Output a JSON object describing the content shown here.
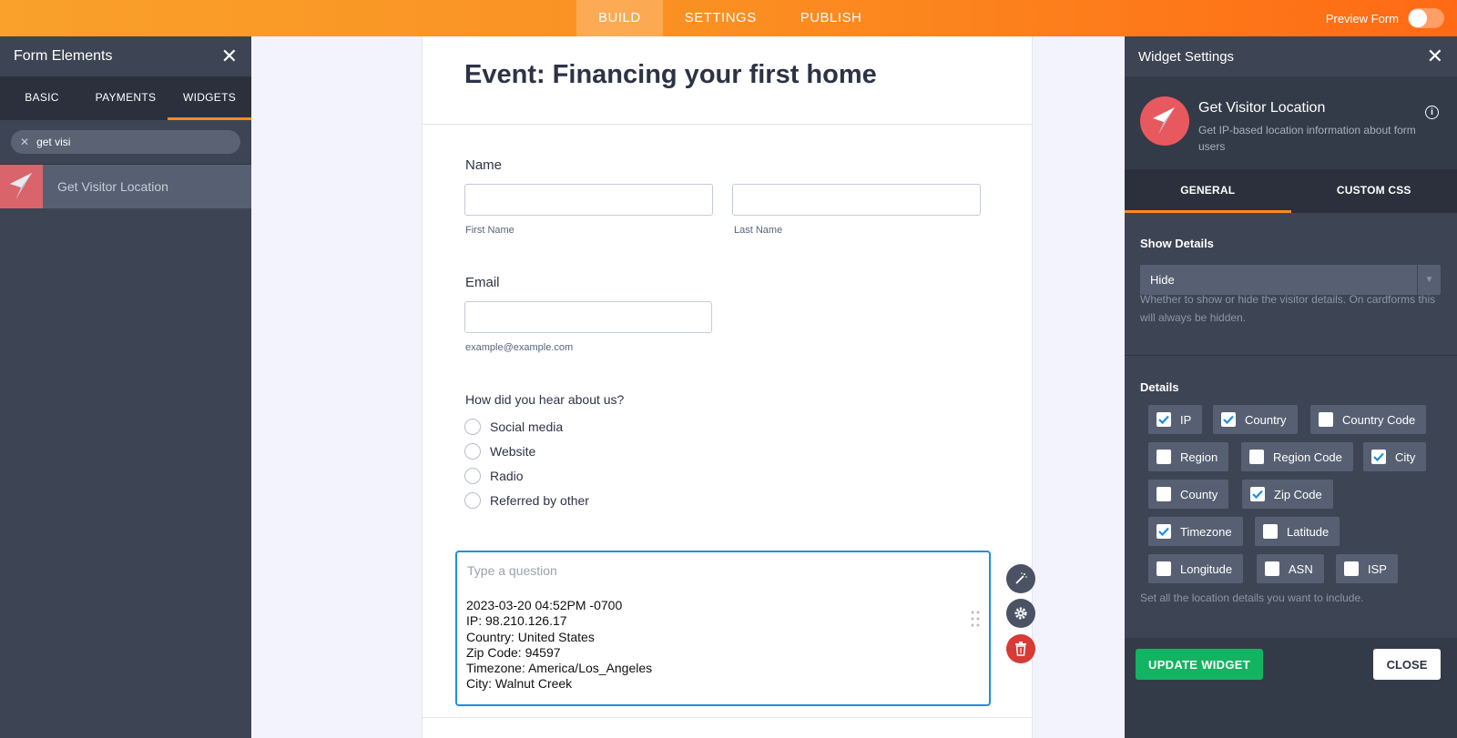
{
  "topbar": {
    "tabs": [
      "BUILD",
      "SETTINGS",
      "PUBLISH"
    ],
    "active_tab": "BUILD",
    "preview_label": "Preview Form",
    "preview_on": false
  },
  "left_panel": {
    "title": "Form Elements",
    "tabs": [
      "BASIC",
      "PAYMENTS",
      "WIDGETS"
    ],
    "active_tab": "WIDGETS",
    "search_value": "get visi",
    "result_label": "Get Visitor Location"
  },
  "form": {
    "title": "Event: Financing your first home",
    "name_label": "Name",
    "first_name_sublabel": "First Name",
    "last_name_sublabel": "Last Name",
    "email_label": "Email",
    "email_sublabel": "example@example.com",
    "hear_label": "How did you hear about us?",
    "hear_options": [
      "Social media",
      "Website",
      "Radio",
      "Referred by other"
    ],
    "question_placeholder": "Type a question",
    "widget_output": [
      "2023-03-20 04:52PM -0700",
      "IP: 98.210.126.17",
      "Country: United States",
      "Zip Code: 94597",
      "Timezone: America/Los_Angeles",
      "City: Walnut Creek"
    ]
  },
  "right_panel": {
    "title": "Widget Settings",
    "widget_name": "Get Visitor Location",
    "widget_desc": "Get IP-based location information about form users",
    "tabs": [
      "GENERAL",
      "CUSTOM CSS"
    ],
    "active_tab": "GENERAL",
    "show_details_label": "Show Details",
    "show_details_value": "Hide",
    "show_details_help": "Whether to show or hide the visitor details. On cardforms this will always be hidden.",
    "details_label": "Details",
    "details": [
      {
        "label": "IP",
        "checked": true
      },
      {
        "label": "Country",
        "checked": true
      },
      {
        "label": "Country Code",
        "checked": false
      },
      {
        "label": "Region",
        "checked": false
      },
      {
        "label": "Region Code",
        "checked": false
      },
      {
        "label": "City",
        "checked": true
      },
      {
        "label": "County",
        "checked": false
      },
      {
        "label": "Zip Code",
        "checked": true
      },
      {
        "label": "Timezone",
        "checked": true
      },
      {
        "label": "Latitude",
        "checked": false
      },
      {
        "label": "Longitude",
        "checked": false
      },
      {
        "label": "ASN",
        "checked": false
      },
      {
        "label": "ISP",
        "checked": false
      }
    ],
    "details_help": "Set all the location details you want to include.",
    "update_button": "UPDATE WIDGET",
    "close_button": "CLOSE"
  },
  "colors": {
    "brand_orange": "#fb8f22",
    "panel_dark": "#3d4453",
    "accent_blue": "#1b8fe0",
    "update_green": "#12b461",
    "delete_red": "#d63b35"
  }
}
